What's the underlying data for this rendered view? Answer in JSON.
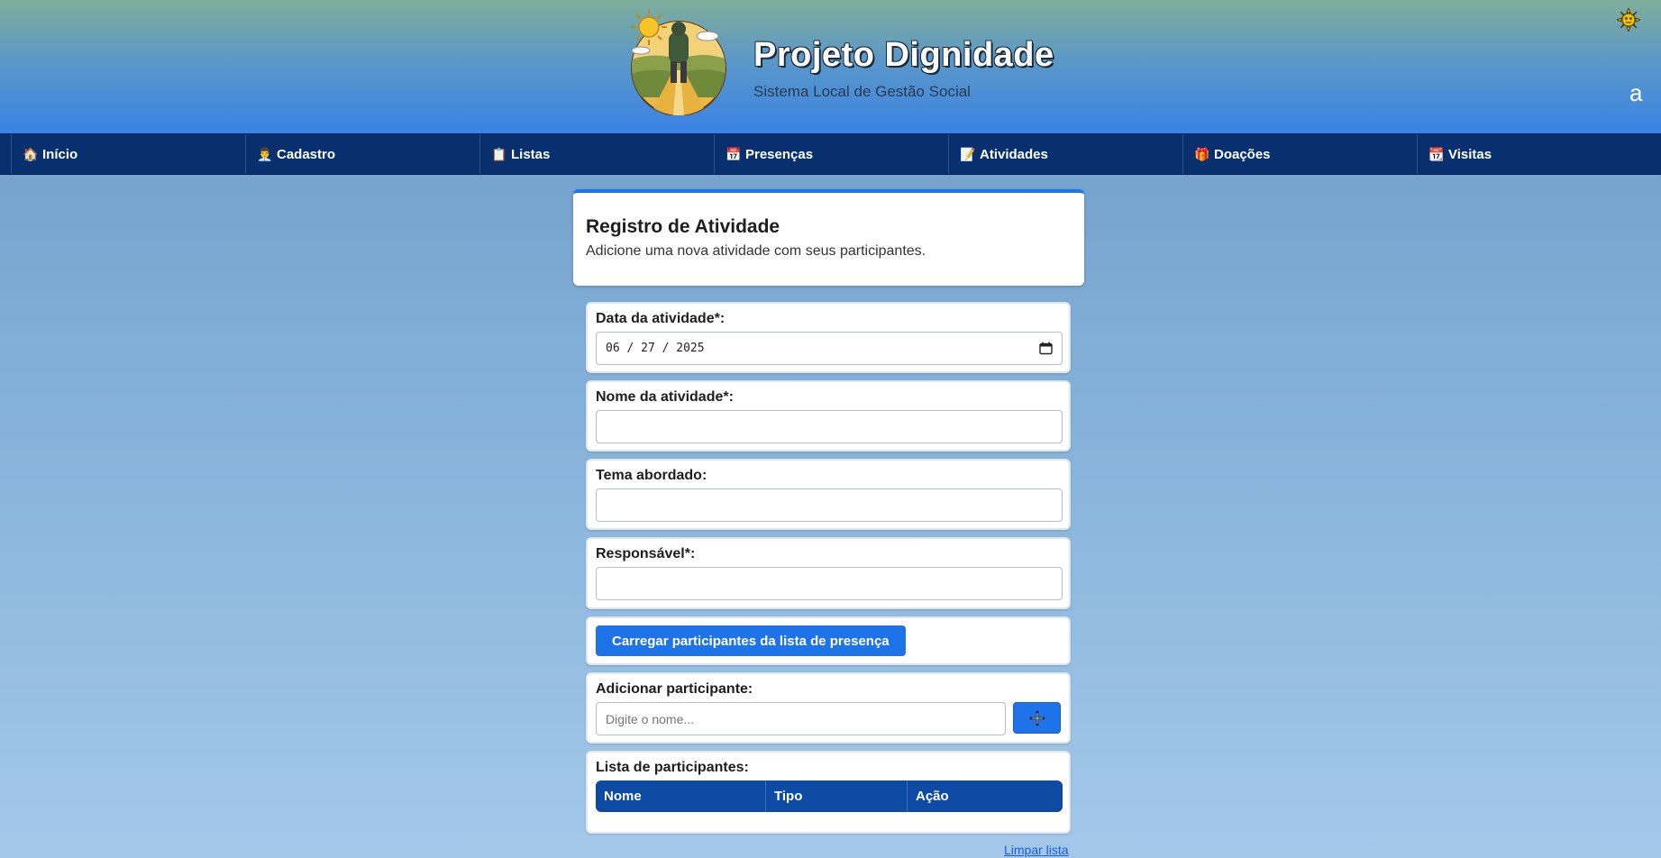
{
  "header": {
    "title": "Projeto Dignidade",
    "subtitle": "Sistema Local de Gestão Social",
    "font_toggle_label": "a",
    "theme_icon": "sun-icon",
    "logo": "person-walking-road-logo"
  },
  "nav": {
    "items": [
      {
        "icon": "🏠",
        "label": "Início"
      },
      {
        "icon": "👨‍💼",
        "label": "Cadastro"
      },
      {
        "icon": "📋",
        "label": "Listas"
      },
      {
        "icon": "📅",
        "label": "Presenças"
      },
      {
        "icon": "📝",
        "label": "Atividades"
      },
      {
        "icon": "🎁",
        "label": "Doações"
      },
      {
        "icon": "📆",
        "label": "Visitas"
      }
    ]
  },
  "card": {
    "title": "Registro de Atividade",
    "description": "Adicione uma nova atividade com seus participantes."
  },
  "form": {
    "date_label": "Data da atividade*:",
    "date_value": "06 / 27 / 2025",
    "name_label": "Nome da atividade*:",
    "name_value": "",
    "theme_label": "Tema abordado:",
    "theme_value": "",
    "responsible_label": "Responsável*:",
    "responsible_value": "",
    "load_button": "Carregar participantes da lista de presença",
    "add_label": "Adicionar participante:",
    "add_placeholder": "Digite o nome...",
    "list_label": "Lista de participantes:",
    "table_headers": [
      "Nome",
      "Tipo",
      "Ação"
    ],
    "clear_link": "Limpar lista"
  },
  "colors": {
    "accent": "#1f73e8",
    "nav_bg": "#082f6e",
    "table_header": "#0c4aa3"
  }
}
